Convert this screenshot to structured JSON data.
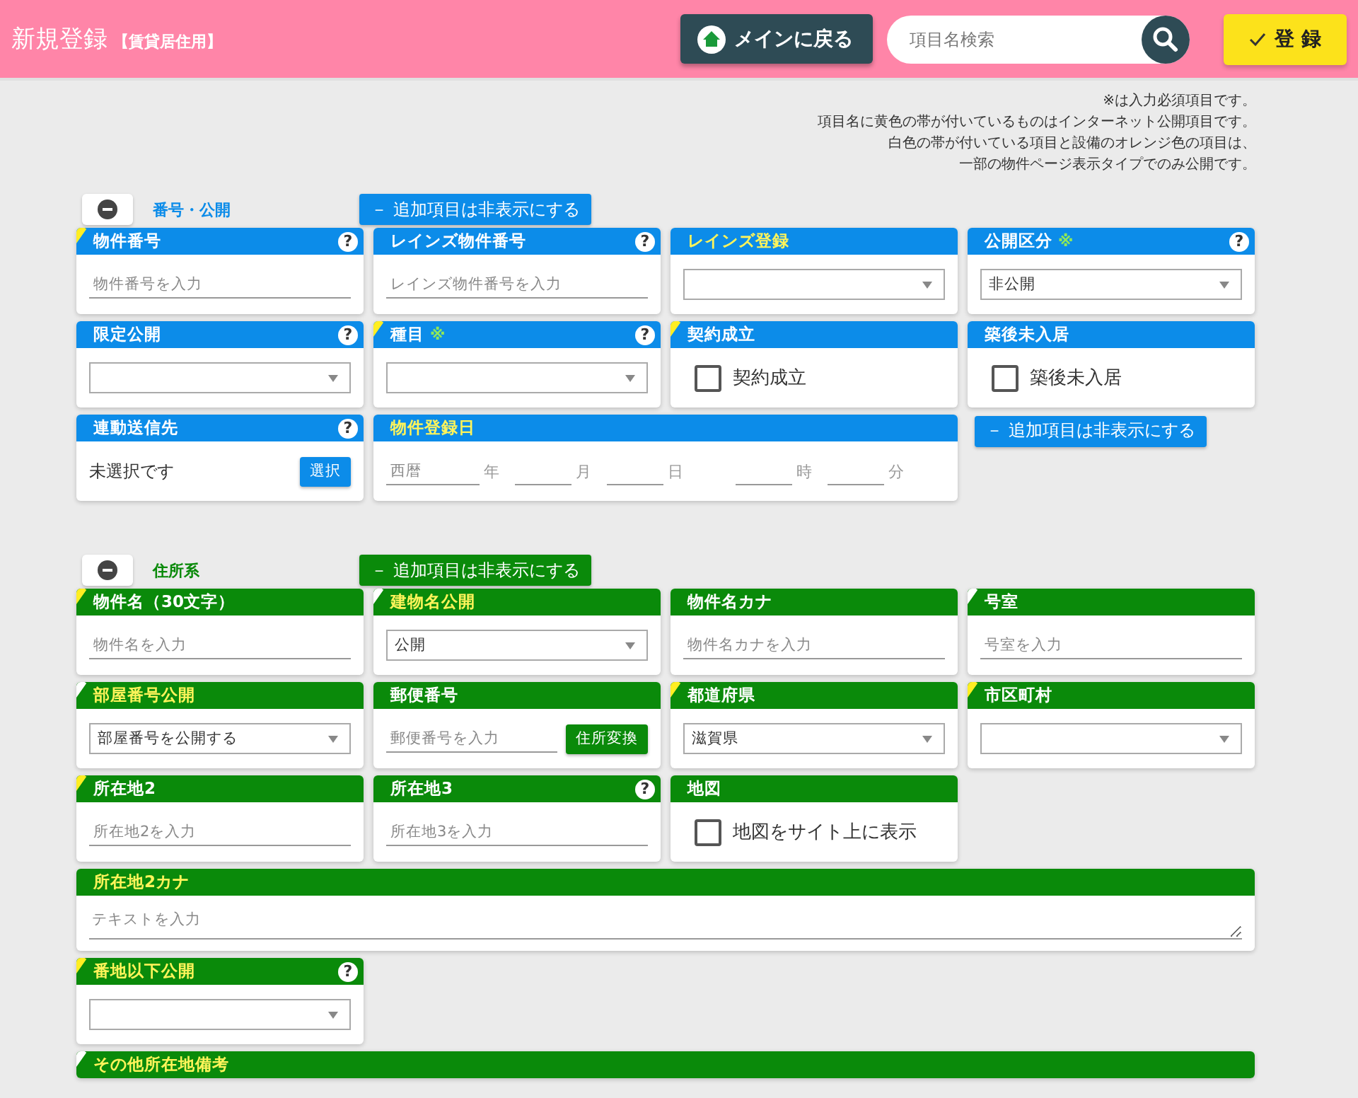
{
  "header": {
    "title": "新規登録",
    "subtitle": "【賃貸居住用】",
    "back_button": "メインに戻る",
    "search": {
      "placeholder": "項目名検索"
    },
    "submit_button": "登 録"
  },
  "notes": [
    "※は入力必須項目です。",
    "項目名に黄色の帯が付いているものはインターネット公開項目です。",
    "白色の帯が付いている項目と設備のオレンジ色の項目は、",
    "一部の物件ページ表示タイプでのみ公開です。"
  ],
  "sections": [
    {
      "color": "#0c8ce9",
      "title": "番号・公開",
      "toggle": "－ 追加項目は非表示にする",
      "fields": [
        {
          "kind": "text",
          "label": "物件番号",
          "band": {
            "color": "#ffee22"
          },
          "highlight": false,
          "help": "?",
          "placeholder": "物件番号を入力"
        },
        {
          "kind": "text",
          "label": "レインズ物件番号",
          "highlight": false,
          "help": "?",
          "placeholder": "レインズ物件番号を入力"
        },
        {
          "kind": "select",
          "label": "レインズ登録",
          "highlight": true
        },
        {
          "kind": "select",
          "label": "公開区分",
          "highlight": false,
          "required_mark": "※",
          "help": "?",
          "value": "非公開"
        },
        {
          "kind": "select",
          "label": "限定公開",
          "highlight": false,
          "help": "?"
        },
        {
          "kind": "select",
          "label": "種目",
          "band": {
            "color": "#ffee22"
          },
          "highlight": false,
          "required_mark": "※",
          "help": "?"
        },
        {
          "kind": "checkbox",
          "label": "契約成立",
          "band": {
            "color": "#ffee22"
          },
          "highlight": false,
          "option": "契約成立",
          "checked": false
        },
        {
          "kind": "checkbox",
          "label": "築後未入居",
          "highlight": false,
          "option": "築後未入居",
          "checked": false
        },
        {
          "kind": "picker",
          "label": "連動送信先",
          "highlight": false,
          "help": "?",
          "value": "未選択です",
          "button": "選択"
        },
        {
          "kind": "date",
          "label": "物件登録日",
          "highlight": true,
          "parts": [
            {
              "placeholder": "西暦",
              "unit": "年"
            },
            {
              "unit": "月"
            },
            {
              "unit": "日"
            },
            {
              "unit": "時"
            },
            {
              "unit": "分"
            }
          ]
        },
        {
          "kind": "toggle",
          "label": "－ 追加項目は非表示にする"
        }
      ]
    },
    {
      "color": "#0a8a0a",
      "title": "住所系",
      "toggle": "－ 追加項目は非表示にする",
      "fields": [
        {
          "kind": "text",
          "label": "物件名（30文字）",
          "band": {
            "color": "#ffee22"
          },
          "highlight": false,
          "placeholder": "物件名を入力"
        },
        {
          "kind": "select",
          "label": "建物名公開",
          "band": {
            "color": "#ffffff"
          },
          "highlight": true,
          "value": "公開"
        },
        {
          "kind": "text",
          "label": "物件名カナ",
          "highlight": false,
          "placeholder": "物件名カナを入力"
        },
        {
          "kind": "text",
          "label": "号室",
          "band": {
            "color": "#ffffff"
          },
          "highlight": false,
          "placeholder": "号室を入力"
        },
        {
          "kind": "select",
          "label": "部屋番号公開",
          "band": {
            "color": "#ffffff"
          },
          "highlight": true,
          "value": "部屋番号を公開する"
        },
        {
          "kind": "text_button",
          "label": "郵便番号",
          "highlight": false,
          "placeholder": "郵便番号を入力",
          "button": "住所変換"
        },
        {
          "kind": "select",
          "label": "都道府県",
          "band": {
            "color": "#ffee22"
          },
          "highlight": false,
          "value": "滋賀県"
        },
        {
          "kind": "select",
          "label": "市区町村",
          "band": {
            "color": "#ffee22"
          },
          "highlight": false
        },
        {
          "kind": "text",
          "label": "所在地2",
          "band": {
            "color": "#ffee22"
          },
          "highlight": false,
          "placeholder": "所在地2を入力"
        },
        {
          "kind": "text",
          "label": "所在地3",
          "highlight": false,
          "help": "?",
          "placeholder": "所在地3を入力"
        },
        {
          "kind": "checkbox",
          "label": "地図",
          "highlight": false,
          "option": "地図をサイト上に表示",
          "checked": false
        },
        {
          "kind": "textarea",
          "label": "所在地2カナ",
          "highlight": true,
          "placeholder": "テキストを入力"
        },
        {
          "kind": "select",
          "label": "番地以下公開",
          "band": {
            "color": "#ffee22"
          },
          "highlight": true,
          "help": "?"
        },
        {
          "kind": "heading",
          "label": "その他所在地備考",
          "band": {
            "color": "#ffffff"
          },
          "highlight": true
        }
      ]
    }
  ]
}
